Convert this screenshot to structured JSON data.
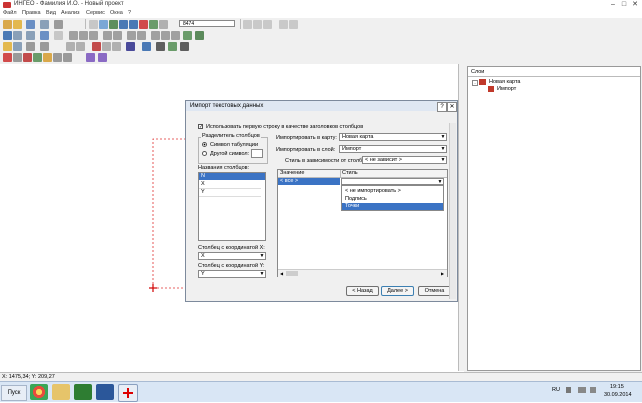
{
  "window": {
    "title": "ИНГЕО - Фамилия И.О. - Новый проект",
    "min": "–",
    "max": "□",
    "close": "✕"
  },
  "menu": [
    "Файл",
    "Правка",
    "Вид",
    "Анализ",
    "Сервис",
    "Окна",
    "?"
  ],
  "toolbar": {
    "scale_value": "8474"
  },
  "layers_panel": {
    "title": "Слои",
    "map_name": "Новая карта",
    "layer_name": "Импорт"
  },
  "statusbar": {
    "coords": "X: 1475,34; Y: 209,27"
  },
  "taskbar": {
    "start": "Пуск",
    "lang": "RU",
    "time": "19:15",
    "date": "30.09.2014"
  },
  "dialog": {
    "title": "Импорт текстовых данных",
    "help": "?",
    "close": "✕",
    "use_header_label": "Использовать первую строку в качестве заголовков столбцов",
    "use_header_checked": "✓",
    "separator_group": "Разделитель столбцов",
    "sep_tab": "Символ табуляции",
    "sep_other": "Другой символ:",
    "column_names_label": "Названия столбцов:",
    "column_names": [
      "N",
      "X",
      "Y"
    ],
    "col_x_label": "Столбец с координатой X:",
    "col_x_value": "X",
    "col_y_label": "Столбец с координатой Y:",
    "col_y_value": "Y",
    "import_map_label": "Импортировать в карту:",
    "import_map_value": "Новая карта",
    "import_layer_label": "Импортировать в слой:",
    "import_layer_value": "Импорт",
    "style_dep_label": "Стиль в зависимости от столбца:",
    "style_dep_value": "< не зависит >",
    "table_headers": [
      "Значение",
      "Стиль"
    ],
    "table_row_value": "< все >",
    "dropdown_options": [
      "< не импортировать >",
      "Подпись",
      "Точки"
    ],
    "dropdown_selected_index": 2,
    "back_button": "< Назад",
    "next_button": "Далее >",
    "cancel_button": "Отмена"
  }
}
